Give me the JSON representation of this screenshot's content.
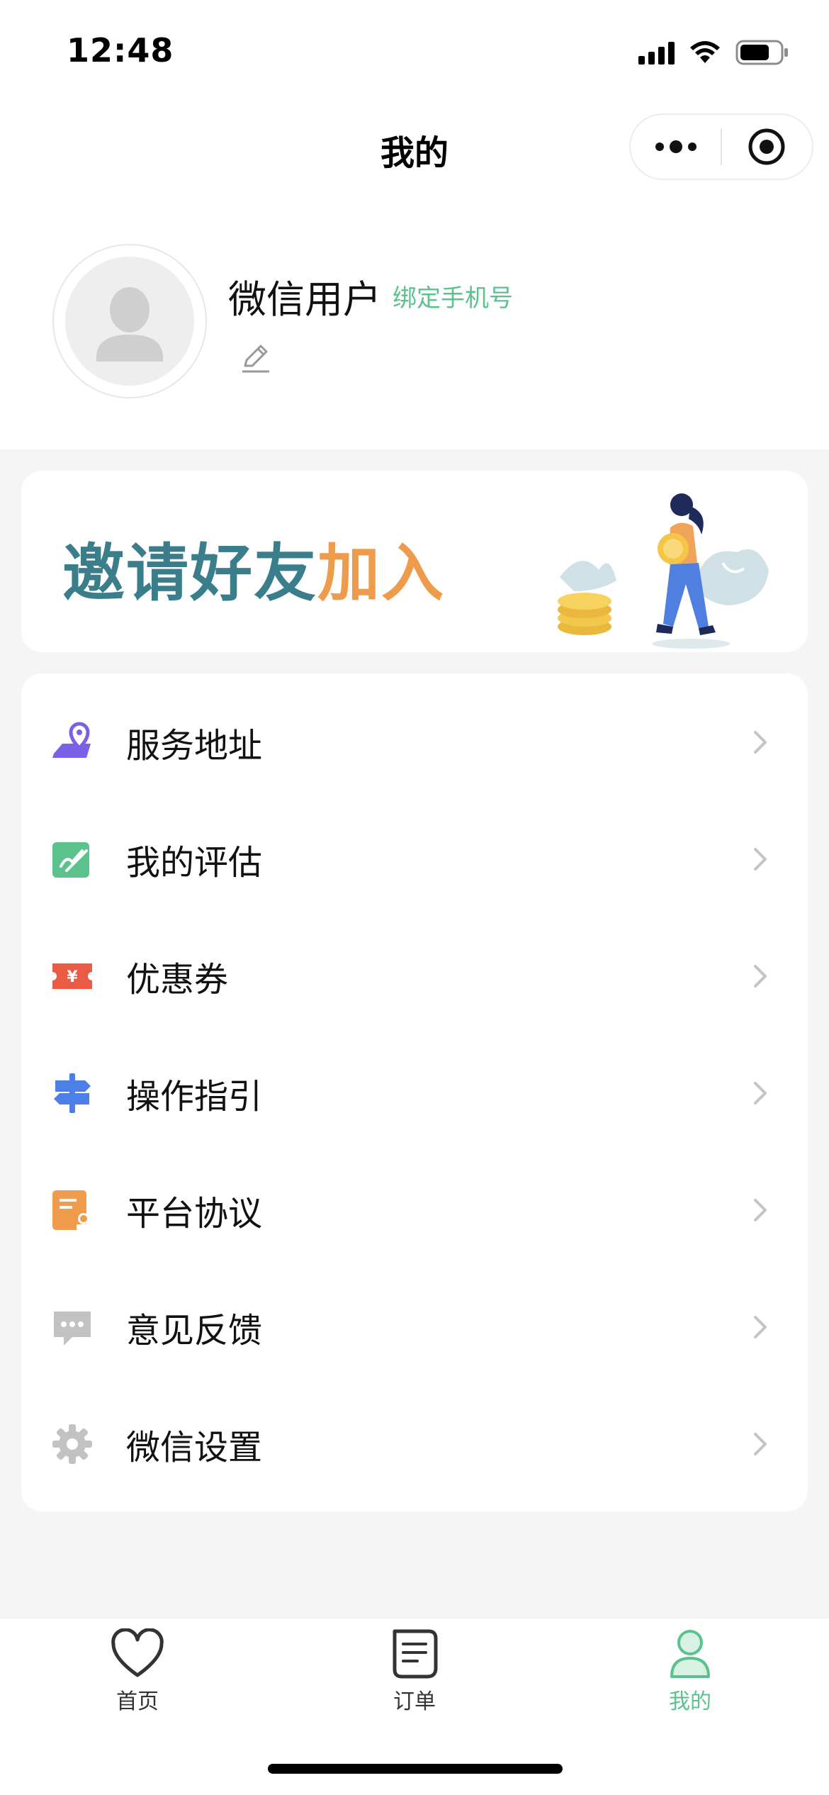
{
  "status_bar": {
    "time": "12:48"
  },
  "nav": {
    "title": "我的"
  },
  "profile": {
    "username": "微信用户",
    "bind_phone_label": "绑定手机号"
  },
  "banner": {
    "text_part1": "邀请好友",
    "text_part2": "加入"
  },
  "menu": {
    "items": [
      {
        "label": "服务地址",
        "icon": "map-pin-icon",
        "color": "#7b61e8"
      },
      {
        "label": "我的评估",
        "icon": "edit-note-icon",
        "color": "#5cc28d"
      },
      {
        "label": "优惠券",
        "icon": "coupon-icon",
        "color": "#ea5a45"
      },
      {
        "label": "操作指引",
        "icon": "signpost-icon",
        "color": "#4c7fe8"
      },
      {
        "label": "平台协议",
        "icon": "document-icon",
        "color": "#ef9b4c"
      },
      {
        "label": "意见反馈",
        "icon": "chat-bubble-icon",
        "color": "#bfbfbf"
      },
      {
        "label": "微信设置",
        "icon": "gear-icon",
        "color": "#bfbfbf"
      }
    ]
  },
  "tabbar": {
    "tabs": [
      {
        "label": "首页",
        "icon": "heart-icon",
        "active": false
      },
      {
        "label": "订单",
        "icon": "order-list-icon",
        "active": false
      },
      {
        "label": "我的",
        "icon": "person-icon",
        "active": true
      }
    ]
  },
  "colors": {
    "accent": "#5cc28d",
    "banner_teal": "#3a7e8c",
    "banner_orange": "#ef9b4c"
  }
}
